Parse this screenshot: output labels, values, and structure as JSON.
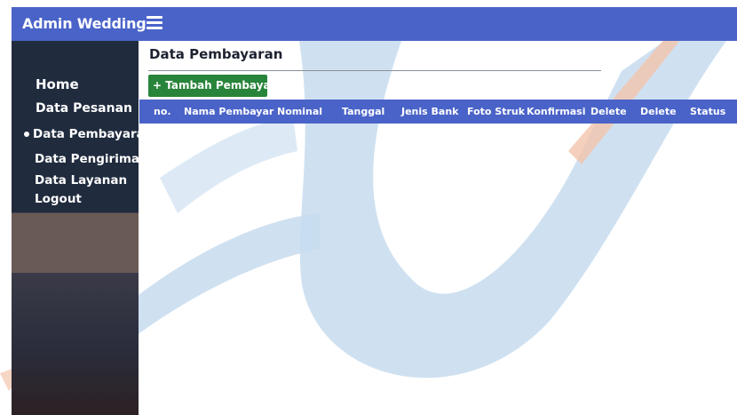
{
  "app": {
    "title": "Admin Wedding"
  },
  "header": {
    "menu_icon": "hamburger-icon"
  },
  "sidebar": {
    "items": [
      {
        "label": "Home"
      },
      {
        "label": "Data Pesanan"
      },
      {
        "label": "Data Pembayaran",
        "active": true
      },
      {
        "label": "Data Pengiriman"
      },
      {
        "label": "Data Layanan"
      },
      {
        "label": "Logout"
      }
    ]
  },
  "main": {
    "title": "Data Pembayaran",
    "add_button_label": "+ Tambah Pembayaran",
    "table": {
      "columns": [
        "no.",
        "Nama Pembayar",
        "Nominal",
        "Tanggal",
        "Jenis Bank",
        "Foto Struk",
        "Konfirmasi",
        "Delete",
        "Delete",
        "Status"
      ],
      "rows": []
    }
  },
  "colors": {
    "topbar": "#4a63c8",
    "sidebar": "#202b3e",
    "add_button": "#28843a",
    "table_header": "#4a63c8"
  }
}
